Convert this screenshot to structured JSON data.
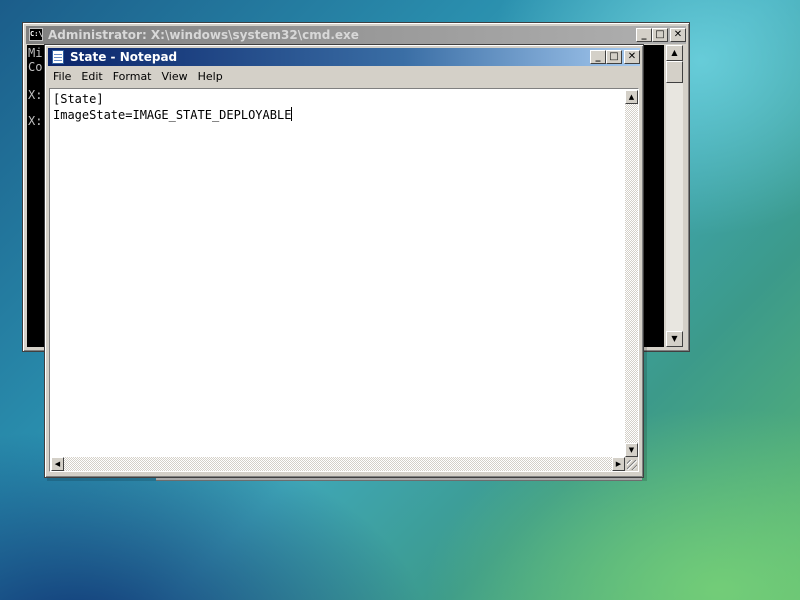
{
  "cmd_window": {
    "title": "Administrator: X:\\windows\\system32\\cmd.exe",
    "icon_text": "C:\\",
    "buttons": {
      "minimize": "_",
      "maximize": "□",
      "close": "✕"
    },
    "lines": [
      "Mi",
      "Co",
      "",
      "X:",
      "",
      "X:"
    ]
  },
  "notepad_window": {
    "title": "State - Notepad",
    "buttons": {
      "minimize": "_",
      "maximize": "□",
      "close": "✕"
    },
    "menu": [
      "File",
      "Edit",
      "Format",
      "View",
      "Help"
    ],
    "content_lines": [
      "[State]",
      "ImageState=IMAGE_STATE_DEPLOYABLE"
    ]
  },
  "icons": {
    "cmd_icon": "command-prompt-icon",
    "notepad_icon": "notepad-icon",
    "scroll_up": "arrow-up-icon",
    "scroll_down": "arrow-down-icon",
    "scroll_left": "arrow-left-icon",
    "scroll_right": "arrow-right-icon"
  }
}
